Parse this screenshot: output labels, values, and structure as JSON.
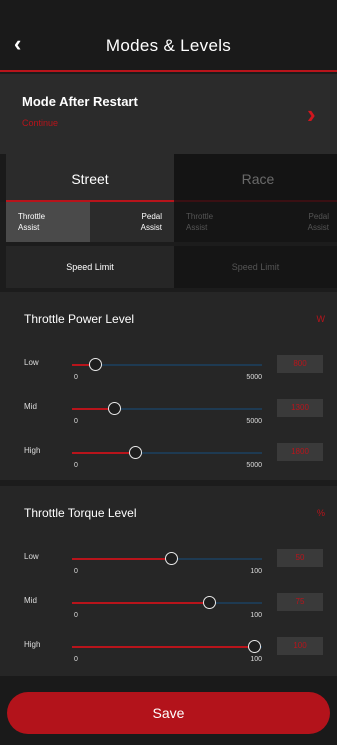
{
  "header": {
    "back_icon": "chevron-left-icon",
    "title": "Modes & Levels"
  },
  "restart": {
    "title": "Mode After Restart",
    "value": "Continue",
    "chevron_icon": "chevron-right-icon"
  },
  "modes": {
    "tabs": [
      {
        "label": "Street",
        "active": true
      },
      {
        "label": "Race",
        "active": false
      }
    ]
  },
  "assist": {
    "items": [
      {
        "line1": "Throttle",
        "line2": "Assist",
        "selected": true
      },
      {
        "line1": "Pedal",
        "line2": "Assist",
        "selected": false
      },
      {
        "line1": "Throttle",
        "line2": "Assist",
        "selected": false
      },
      {
        "line1": "Pedal",
        "line2": "Assist",
        "selected": false
      }
    ]
  },
  "speed": {
    "items": [
      {
        "label": "Speed Limit"
      },
      {
        "label": "Speed Limit"
      }
    ]
  },
  "power": {
    "title": "Throttle Power Level",
    "unit": "W",
    "rows": [
      {
        "label": "Low",
        "min": "0",
        "max": "5000",
        "value": "800",
        "level": 0.12
      },
      {
        "label": "Mid",
        "min": "0",
        "max": "5000",
        "value": "1300",
        "level": 0.22
      },
      {
        "label": "High",
        "min": "0",
        "max": "5000",
        "value": "1800",
        "level": 0.33
      }
    ]
  },
  "torque": {
    "title": "Throttle Torque Level",
    "unit": "%",
    "rows": [
      {
        "label": "Low",
        "min": "0",
        "max": "100",
        "value": "50",
        "level": 0.52
      },
      {
        "label": "Mid",
        "min": "0",
        "max": "100",
        "value": "75",
        "level": 0.72
      },
      {
        "label": "High",
        "min": "0",
        "max": "100",
        "value": "100",
        "level": 0.96
      }
    ]
  },
  "footer": {
    "save_label": "Save"
  },
  "colors": {
    "accent": "#b8141b",
    "background": "#1c1c1c",
    "panel": "#262626",
    "track": "#1e3a52"
  }
}
